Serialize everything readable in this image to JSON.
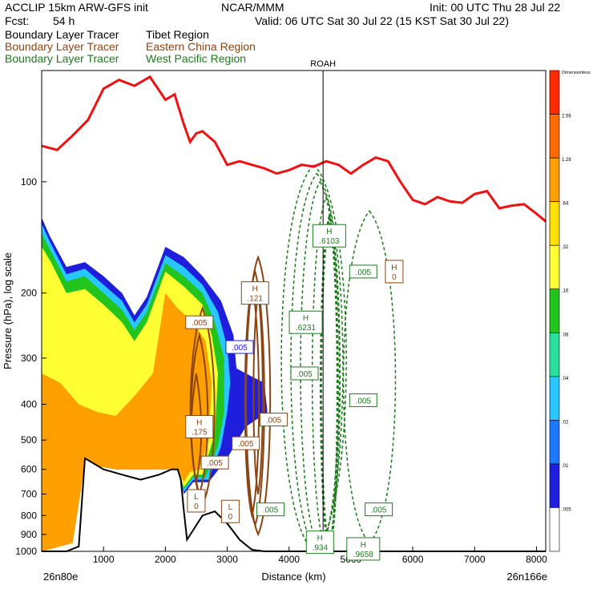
{
  "header": {
    "model": "ACCLIP 15km ARW-GFS init",
    "org": "NCAR/MMM",
    "init": "Init: 00 UTC Thu 28 Jul 22",
    "fcst_label": "Fcst:",
    "fcst_value": "54 h",
    "valid": "Valid: 06 UTC Sat 30 Jul 22 (15 KST Sat 30 Jul 22)"
  },
  "tracers": [
    {
      "name": "Boundary Layer Tracer",
      "region": "Tibet Region",
      "color": "#000000"
    },
    {
      "name": "Boundary Layer Tracer",
      "region": "Eastern China Region",
      "color": "#8B4513"
    },
    {
      "name": "Boundary Layer Tracer",
      "region": "West Pacific Region",
      "color": "#1E7A1E"
    }
  ],
  "chart_data": {
    "type": "cross-section",
    "xlabel": "Distance (km)",
    "ylabel": "Pressure (hPa), log scale",
    "xlim": [
      0,
      8150
    ],
    "ylim": [
      1000,
      50
    ],
    "x_ticks": [
      "1000",
      "2000",
      "3000",
      "4000",
      "5000",
      "6000",
      "7000",
      "8000"
    ],
    "y_ticks": [
      "100",
      "200",
      "300",
      "400",
      "500",
      "600",
      "700",
      "800",
      "900",
      "1000"
    ],
    "start_label": "26n80e",
    "end_label": "26n166e",
    "marker": {
      "label": "ROAH",
      "x": 4550
    },
    "colorbar": {
      "levels": [
        "Dimensionless",
        "2.56",
        "1.28",
        ".64",
        ".32",
        ".16",
        ".08",
        ".04",
        ".02",
        ".01",
        ".005"
      ],
      "colors": [
        "#FF2A00",
        "#FF6A00",
        "#FF9F00",
        "#FFE000",
        "#FFFF33",
        "#22C41E",
        "#28E0A0",
        "#29C7FF",
        "#1E78FF",
        "#1E1EDC",
        "#FFFFFF"
      ]
    },
    "tropopause": {
      "color": "#EE1111",
      "x": [
        0,
        250,
        500,
        750,
        1000,
        1250,
        1500,
        1750,
        2000,
        2150,
        2300,
        2400,
        2500,
        2600,
        2800,
        3000,
        3200,
        3400,
        3600,
        3800,
        4000,
        4200,
        4400,
        4600,
        4800,
        5000,
        5200,
        5400,
        5600,
        5800,
        6000,
        6200,
        6400,
        6600,
        6800,
        7000,
        7200,
        7400,
        7600,
        7800,
        8000,
        8150
      ],
      "y": [
        80,
        82,
        75,
        68,
        56,
        53,
        55,
        52,
        60,
        58,
        70,
        78,
        74,
        73,
        78,
        90,
        88,
        90,
        92,
        95,
        93,
        90,
        91,
        88,
        90,
        95,
        90,
        86,
        88,
        100,
        112,
        115,
        110,
        113,
        114,
        108,
        106,
        118,
        116,
        115,
        122,
        128
      ]
    },
    "terrain": {
      "color": "#000000",
      "x": [
        0,
        400,
        600,
        700,
        1000,
        1300,
        1600,
        1900,
        2100,
        2200,
        2250,
        2300,
        2350,
        2600,
        2800,
        3000,
        3200,
        3400,
        3600,
        3900,
        4200,
        4800,
        5600,
        6800,
        8150
      ],
      "y": [
        1000,
        1000,
        970,
        560,
        600,
        620,
        640,
        620,
        600,
        600,
        640,
        780,
        930,
        800,
        780,
        840,
        930,
        990,
        1000,
        1000,
        1000,
        1000,
        1000,
        1000,
        1000
      ]
    },
    "annotations": [
      {
        "text": "H",
        "value": ".6103",
        "x": 4650,
        "y": 140,
        "color": "#1E7A1E"
      },
      {
        "text": "",
        "value": ".005",
        "x": 5200,
        "y": 175,
        "color": "#1E7A1E"
      },
      {
        "text": "H",
        "value": "0",
        "x": 5700,
        "y": 175,
        "color": "#8B4513"
      },
      {
        "text": "H",
        "value": ".121",
        "x": 3450,
        "y": 200,
        "color": "#8B4513"
      },
      {
        "text": "H",
        "value": ".6231",
        "x": 4270,
        "y": 240,
        "color": "#1E7A1E"
      },
      {
        "text": "",
        "value": ".005",
        "x": 2550,
        "y": 240,
        "color": "#8B4513"
      },
      {
        "text": "",
        "value": ".005",
        "x": 3200,
        "y": 280,
        "color": "#1E1EDC"
      },
      {
        "text": "",
        "value": ".005",
        "x": 4250,
        "y": 330,
        "color": "#1E7A1E"
      },
      {
        "text": "",
        "value": ".005",
        "x": 5200,
        "y": 390,
        "color": "#1E7A1E"
      },
      {
        "text": "",
        "value": ".005",
        "x": 3750,
        "y": 440,
        "color": "#8B4513"
      },
      {
        "text": "H",
        "value": ".175",
        "x": 2550,
        "y": 460,
        "color": "#8B4513"
      },
      {
        "text": "",
        "value": ".005",
        "x": 3300,
        "y": 510,
        "color": "#8B4513"
      },
      {
        "text": "",
        "value": ".005",
        "x": 2800,
        "y": 575,
        "color": "#8B4513"
      },
      {
        "text": "L",
        "value": "0",
        "x": 2500,
        "y": 730,
        "color": "#8B4513"
      },
      {
        "text": "L",
        "value": "0",
        "x": 3050,
        "y": 780,
        "color": "#8B4513"
      },
      {
        "text": "",
        "value": ".005",
        "x": 3700,
        "y": 770,
        "color": "#1E7A1E"
      },
      {
        "text": "",
        "value": ".005",
        "x": 5450,
        "y": 770,
        "color": "#1E7A1E"
      },
      {
        "text": "H",
        "value": ".934",
        "x": 4500,
        "y": 945,
        "color": "#1E7A1E"
      },
      {
        "text": "H",
        "value": ".9658",
        "x": 5200,
        "y": 985,
        "color": "#1E7A1E"
      }
    ]
  }
}
